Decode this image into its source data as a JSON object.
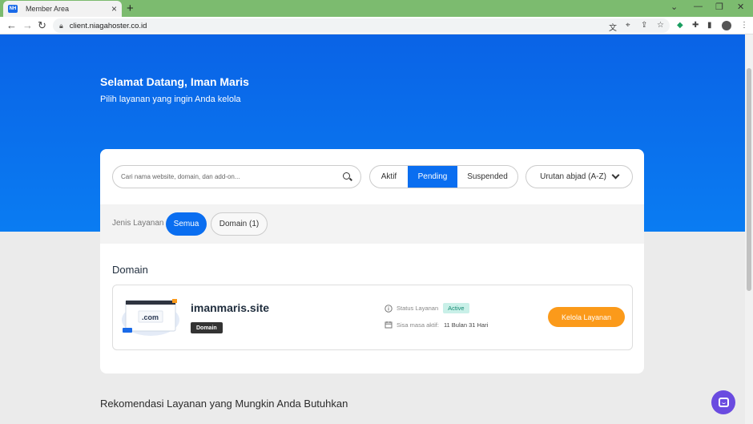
{
  "browser": {
    "tab_title": "Member Area",
    "favicon_text": "NH",
    "url": "client.niagahoster.co.id"
  },
  "hero": {
    "title": "Selamat Datang, Iman Maris",
    "subtitle": "Pilih layanan yang ingin Anda kelola"
  },
  "search": {
    "placeholder": "Cari nama website, domain, dan add-on..."
  },
  "status_filter": {
    "options": [
      "Aktif",
      "Pending",
      "Suspended"
    ],
    "selected": "Pending"
  },
  "sort": {
    "label": "Urutan abjad (A-Z)"
  },
  "service_filter": {
    "label": "Jenis Layanan",
    "options": [
      "Semua",
      "Domain (1)"
    ],
    "selected": "Semua"
  },
  "section": {
    "title": "Domain"
  },
  "domain": {
    "name": "imanmaris.site",
    "tag": "Domain",
    "thumb_text": ".com",
    "status_label": "Status Layanan",
    "status_value": "Active",
    "expiry_label": "Sisa masa aktif:",
    "expiry_value": "11 Bulan 31 Hari",
    "manage_button": "Kelola Layanan"
  },
  "recommend": {
    "title": "Rekomendasi Layanan yang Mungkin Anda Butuhkan"
  },
  "colors": {
    "primary": "#0a6ef0",
    "accent": "#fb9a1a",
    "status_bg": "#c9f0e8",
    "chat": "#6a4be0"
  }
}
